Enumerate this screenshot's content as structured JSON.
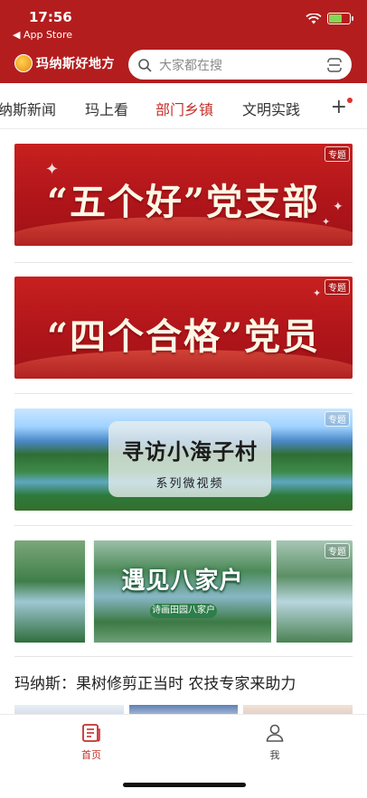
{
  "status_bar": {
    "time": "17:56",
    "back_label": "◀ App Store"
  },
  "header": {
    "logo_text": "玛纳斯好地方",
    "search_placeholder": "大家都在搜",
    "brand_color": "#b41d1d"
  },
  "tabs": {
    "items": [
      "纳斯新闻",
      "玛上看",
      "部门乡镇",
      "文明实践"
    ],
    "active": "部门乡镇",
    "more_label": "+"
  },
  "banners": [
    {
      "headline": "“五个好”党支部",
      "tag": "专题"
    },
    {
      "headline": "“四个合格”党员",
      "tag": "专题"
    },
    {
      "headline": "寻访小海子村",
      "subtitle": "系列微视频",
      "tag": "专题"
    },
    {
      "headline": "遇见八家户",
      "subtitle": "诗画田园八家户",
      "tag": "专题"
    }
  ],
  "news": {
    "title": "玛纳斯：果树修剪正当时 农技专家来助力"
  },
  "tabbar": {
    "home_label": "首页",
    "me_label": "我",
    "active_color": "#c4302b"
  }
}
